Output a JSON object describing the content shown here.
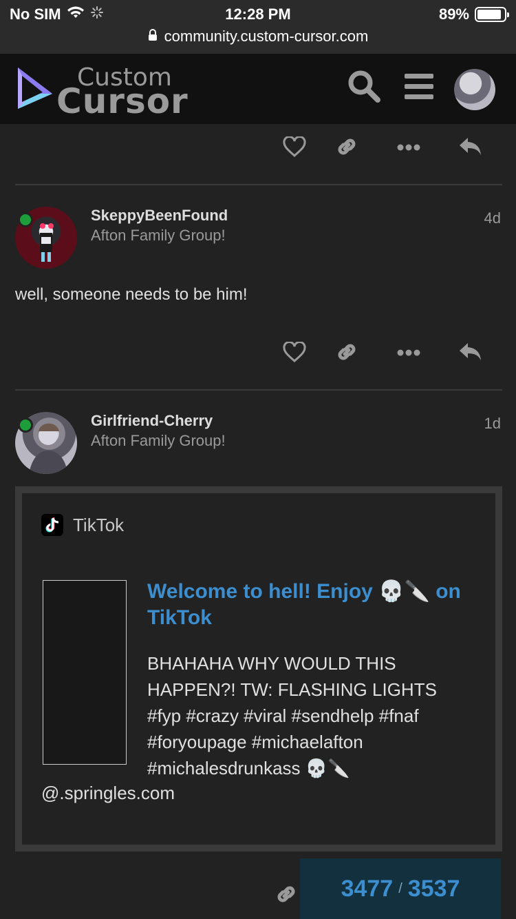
{
  "status_bar": {
    "carrier": "No SIM",
    "time": "12:28 PM",
    "battery_percent": "89%",
    "battery_level": 0.89,
    "url": "community.custom-cursor.com"
  },
  "header": {
    "logo_top": "Custom",
    "logo_bottom": "Cursor",
    "icons": [
      "search-icon",
      "hamburger-menu-icon",
      "user-avatar"
    ]
  },
  "posts": [
    {
      "username": "SkeppyBeenFound",
      "user_title": "Afton Family Group!",
      "date": "4d",
      "body": "well, someone needs to be him!"
    },
    {
      "username": "Girlfriend-Cherry",
      "user_title": "Afton Family Group!",
      "date": "1d",
      "onebox": {
        "source": "TikTok",
        "title": "Welcome to hell! Enjoy 💀🔪 on TikTok",
        "description": "BHAHAHA WHY WOULD THIS HAPPEN?! TW: FLASHING LIGHTS #fyp #crazy #viral #sendhelp #fnaf #foryoupage #michaelafton #michalesdrunkass 💀🔪",
        "extra": "@.springles.com"
      }
    }
  ],
  "timeline": {
    "current": "3477",
    "separator": "/",
    "total": "3537"
  },
  "colors": {
    "accent": "#3c8ecf",
    "background": "#222222",
    "header": "#111111",
    "online": "#1e9e3a"
  }
}
